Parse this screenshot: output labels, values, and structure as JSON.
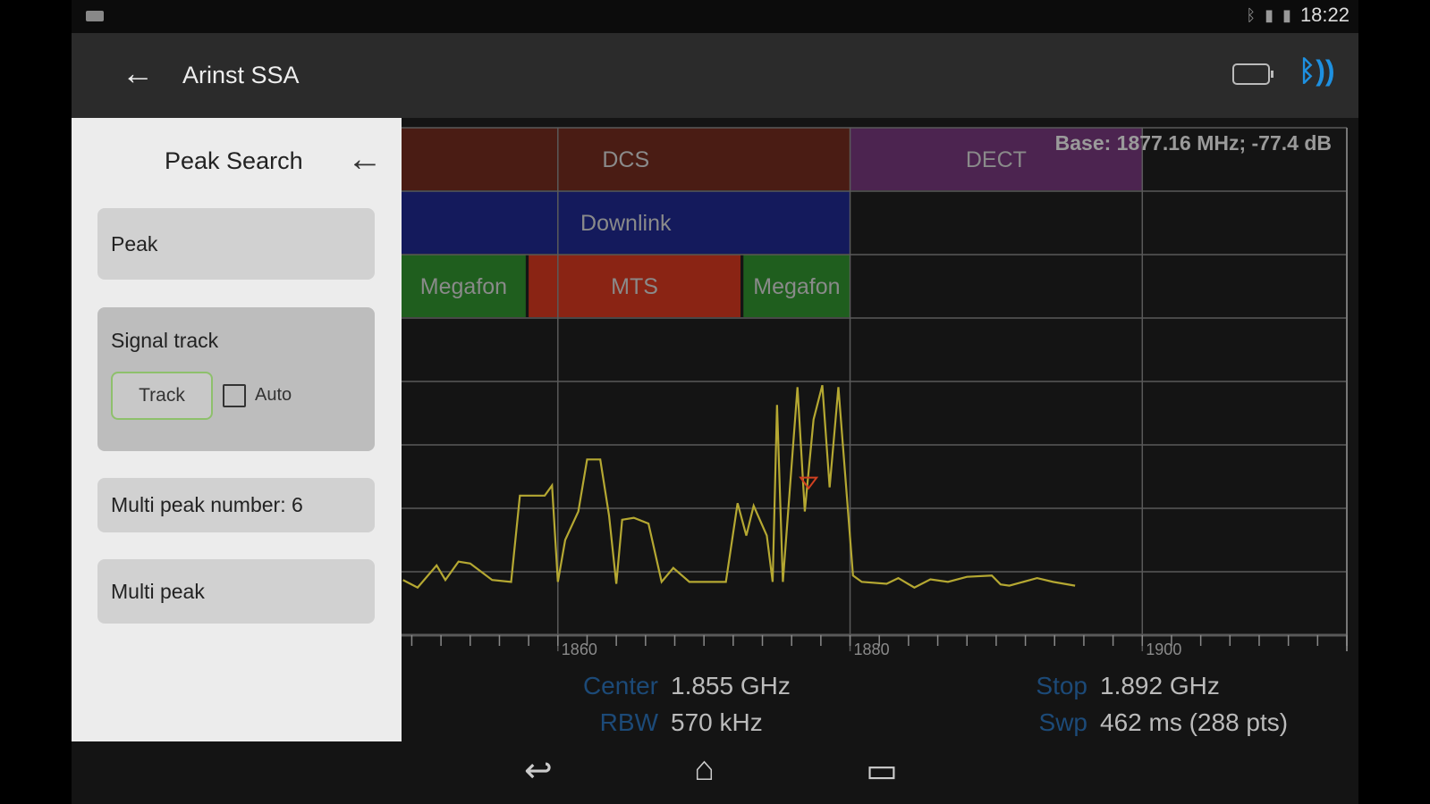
{
  "status_bar": {
    "time": "18:22",
    "icons": [
      "video-icon",
      "bluetooth-icon",
      "signal-icon",
      "battery-icon"
    ]
  },
  "app_bar": {
    "title": "Arinst SSA",
    "icons": [
      "back-arrow-icon",
      "device-battery-icon",
      "bluetooth-connected-icon"
    ],
    "bluetooth_color": "#1e90e0"
  },
  "panel": {
    "title": "Peak Search",
    "peak_label": "Peak",
    "signal_track_label": "Signal track",
    "track_label": "Track",
    "auto_label": "Auto",
    "auto_checked": false,
    "multi_peak_number_label": "Multi peak number: 6",
    "multi_peak_label": "Multi peak"
  },
  "chart_data": {
    "type": "line",
    "xlim": [
      1849.3,
      1914
    ],
    "x_ticks_major": [
      1860,
      1880,
      1900
    ],
    "x_tick_labels": [
      "1860",
      "1880",
      "1900"
    ],
    "x_minor_step": 2,
    "ylim": [
      0,
      8
    ],
    "grid": true,
    "trace_color": "#b5a832",
    "marker": {
      "text": "Base:  1877.16 MHz;    -77.4 dB",
      "freq": 1877.16,
      "level": 2.4,
      "color": "#d04020"
    },
    "bands": [
      {
        "label": "DCS",
        "start": 1849.3,
        "end": 1880,
        "row": 0,
        "color": "#4a1c14"
      },
      {
        "label": "DECT",
        "start": 1880,
        "end": 1900,
        "row": 0,
        "color": "#4c2450"
      },
      {
        "label": "Downlink",
        "start": 1849.3,
        "end": 1880,
        "row": 1,
        "color": "#141a5c"
      },
      {
        "label": "Megafon",
        "start": 1849.3,
        "end": 1857.8,
        "row": 2,
        "color": "#1f5e1e"
      },
      {
        "label": "MTS",
        "start": 1858,
        "end": 1872.5,
        "row": 2,
        "color": "#8a2414"
      },
      {
        "label": "Megafon",
        "start": 1872.7,
        "end": 1880,
        "row": 2,
        "color": "#1f5e1e"
      }
    ],
    "trace": [
      [
        1849.4,
        0.87
      ],
      [
        1850.4,
        0.75
      ],
      [
        1851.7,
        1.1
      ],
      [
        1852.3,
        0.87
      ],
      [
        1853.2,
        1.16
      ],
      [
        1854,
        1.13
      ],
      [
        1855.5,
        0.87
      ],
      [
        1856.8,
        0.84
      ],
      [
        1857.4,
        2.2
      ],
      [
        1859.1,
        2.2
      ],
      [
        1859.6,
        2.36
      ],
      [
        1860,
        0.84
      ],
      [
        1860.5,
        1.5
      ],
      [
        1861.4,
        1.95
      ],
      [
        1862,
        2.77
      ],
      [
        1862.9,
        2.77
      ],
      [
        1863.5,
        1.89
      ],
      [
        1864,
        0.81
      ],
      [
        1864.4,
        1.82
      ],
      [
        1865.2,
        1.85
      ],
      [
        1866.2,
        1.76
      ],
      [
        1867.1,
        0.84
      ],
      [
        1867.9,
        1.06
      ],
      [
        1869,
        0.84
      ],
      [
        1871.5,
        0.84
      ],
      [
        1872.3,
        2.08
      ],
      [
        1872.9,
        1.57
      ],
      [
        1873.4,
        2.04
      ],
      [
        1874.3,
        1.57
      ],
      [
        1874.7,
        0.84
      ],
      [
        1875,
        3.63
      ],
      [
        1875.4,
        0.84
      ],
      [
        1876.4,
        3.91
      ],
      [
        1876.9,
        1.95
      ],
      [
        1877.5,
        3.4
      ],
      [
        1878.1,
        3.94
      ],
      [
        1878.6,
        2.33
      ],
      [
        1879.2,
        3.91
      ],
      [
        1880.2,
        0.94
      ],
      [
        1880.8,
        0.84
      ],
      [
        1882.5,
        0.81
      ],
      [
        1883.3,
        0.9
      ],
      [
        1884.4,
        0.75
      ],
      [
        1885.5,
        0.88
      ],
      [
        1886.7,
        0.84
      ],
      [
        1888,
        0.92
      ],
      [
        1889.7,
        0.94
      ],
      [
        1890.3,
        0.8
      ],
      [
        1890.9,
        0.78
      ],
      [
        1892.8,
        0.9
      ],
      [
        1893.9,
        0.84
      ],
      [
        1895.4,
        0.78
      ]
    ]
  },
  "info": {
    "center_label": "Center",
    "center_value": "1.855 GHz",
    "rbw_label": "RBW",
    "rbw_value": "570 kHz",
    "stop_label": "Stop",
    "stop_value": "1.892 GHz",
    "swp_label": "Swp",
    "swp_value": "462 ms (288 pts)"
  },
  "nav_bar": {
    "back": "↩",
    "home": "⌂",
    "recents": "▭"
  }
}
